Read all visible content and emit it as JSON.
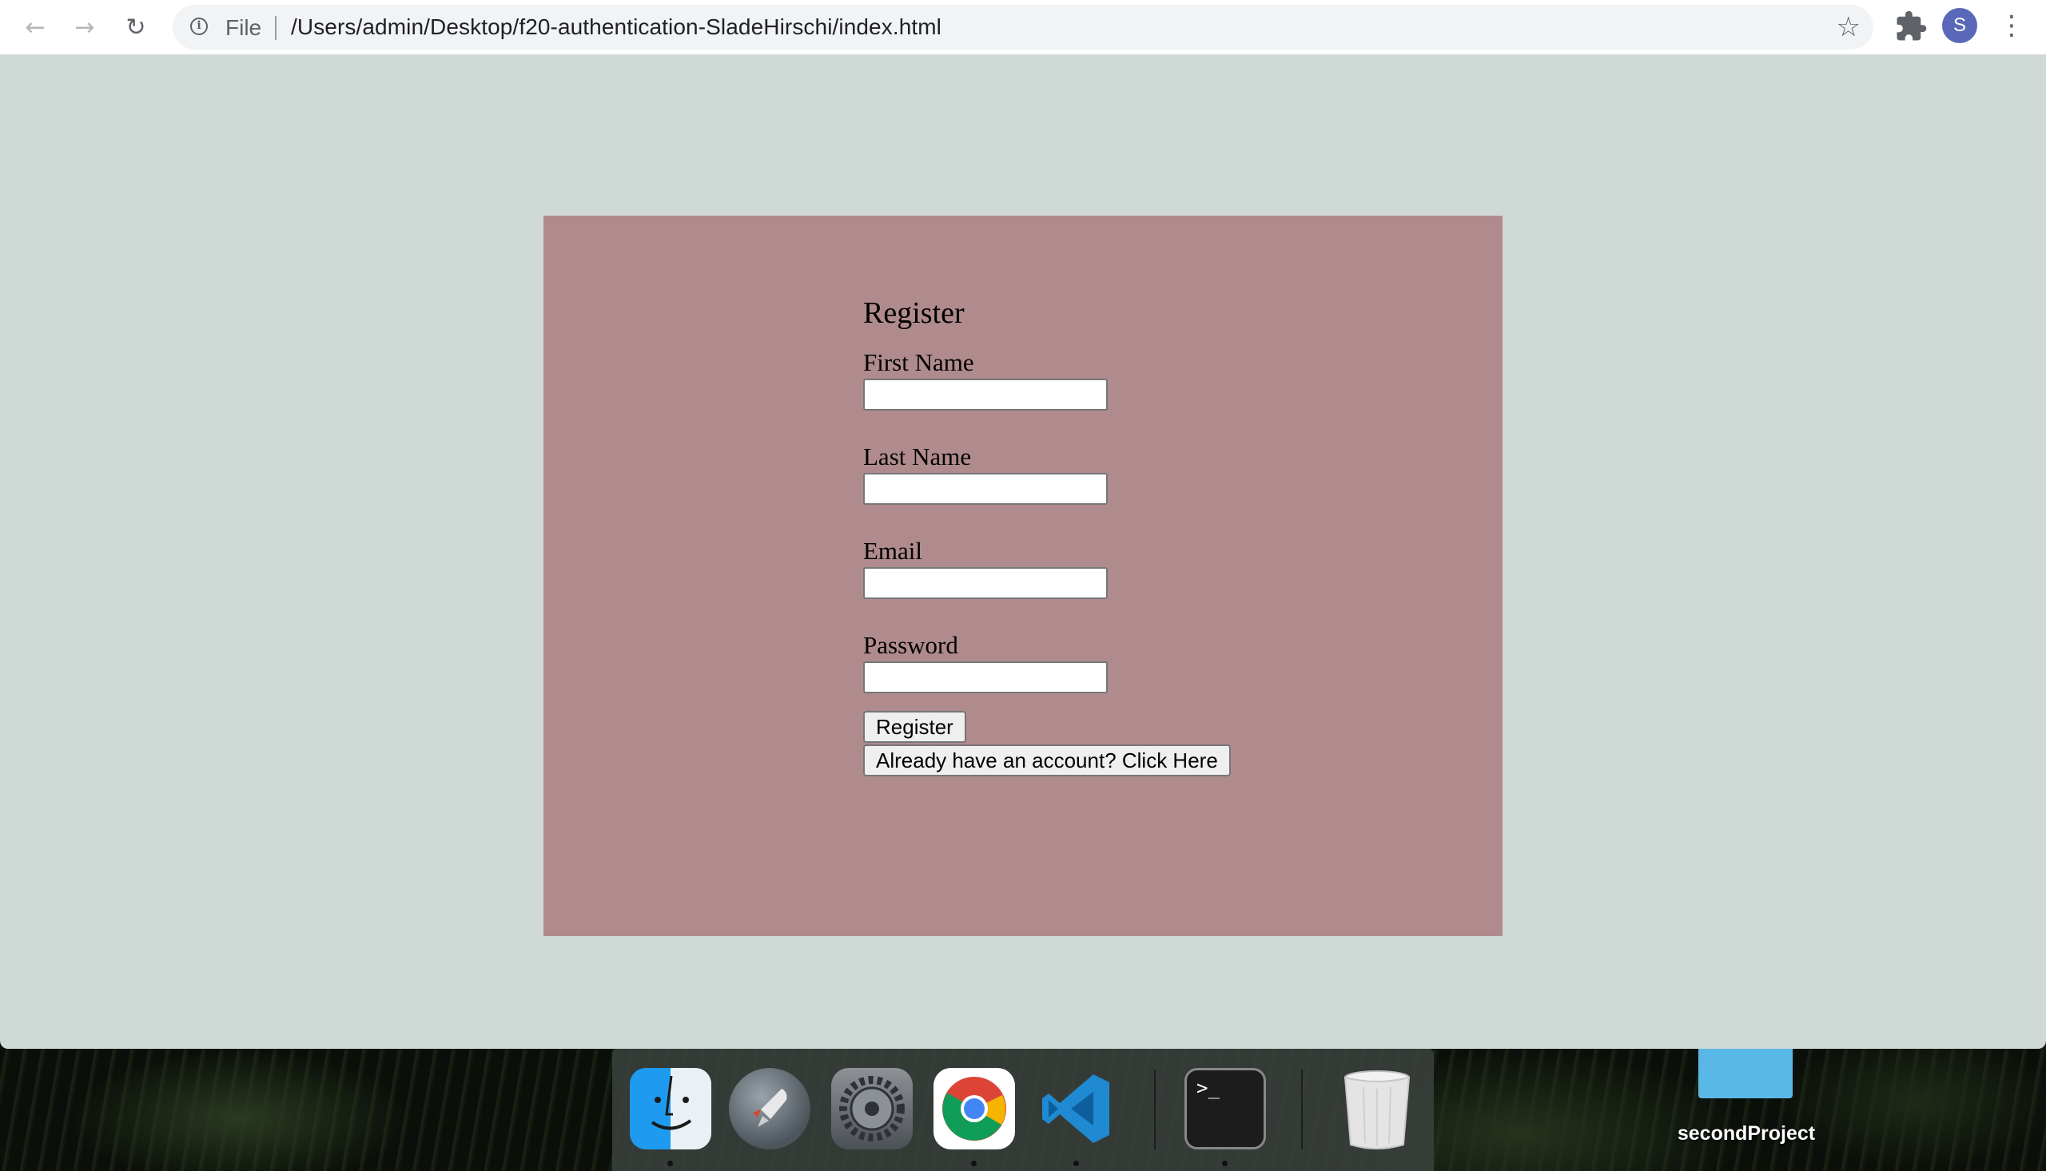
{
  "browser": {
    "scheme_label": "File",
    "url": "/Users/admin/Desktop/f20-authentication-SladeHirschi/index.html",
    "profile_initial": "S"
  },
  "form": {
    "title": "Register",
    "fields": [
      {
        "label": "First Name",
        "value": ""
      },
      {
        "label": "Last Name",
        "value": ""
      },
      {
        "label": "Email",
        "value": ""
      },
      {
        "label": "Password",
        "value": ""
      }
    ],
    "register_button": "Register",
    "login_button": "Already have an account? Click Here"
  },
  "dock": {
    "items": [
      "finder-icon",
      "launchpad-icon",
      "system-preferences-icon",
      "chrome-icon",
      "vscode-icon",
      "terminal-icon",
      "trash-icon"
    ]
  },
  "desktop": {
    "folder_label": "secondProject"
  },
  "colors": {
    "page_background": "#cfd9d6",
    "card_background": "#b08b8e",
    "avatar": "#5968b8"
  }
}
